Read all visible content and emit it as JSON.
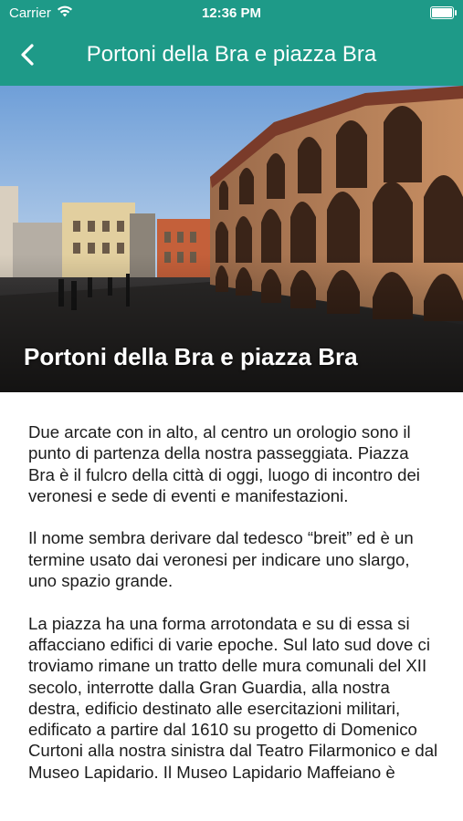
{
  "status_bar": {
    "carrier": "Carrier",
    "time": "12:36 PM"
  },
  "header": {
    "title": "Portoni della Bra e piazza Bra"
  },
  "hero": {
    "title": "Portoni della Bra e piazza Bra"
  },
  "content": {
    "paragraphs": [
      "Due arcate con in alto, al centro un orologio sono il punto di partenza della nostra passeggiata. Piazza Bra è il  fulcro della città di oggi, luogo di incontro dei veronesi e sede di eventi e manifestazioni.",
      "Il nome sembra derivare dal tedesco “breit” ed è un termine usato dai veronesi per indicare uno slargo, uno spazio grande.",
      "La piazza ha una forma arrotondata e su di essa si affacciano edifici di varie epoche. Sul lato sud dove ci troviamo rimane un tratto delle mura comunali del XII secolo, interrotte dalla Gran Guardia, alla nostra destra, edificio destinato alle esercitazioni militari, edificato a partire dal 1610 su progetto di Domenico Curtoni  alla nostra sinistra dal Teatro Filarmonico e dal Museo Lapidario. Il Museo Lapidario Maffeiano è"
    ]
  },
  "colors": {
    "header_bg": "#1e9a88",
    "text": "#1c1c1c"
  },
  "icons": {
    "back": "chevron-left-icon",
    "wifi": "wifi-icon",
    "battery": "battery-icon"
  }
}
